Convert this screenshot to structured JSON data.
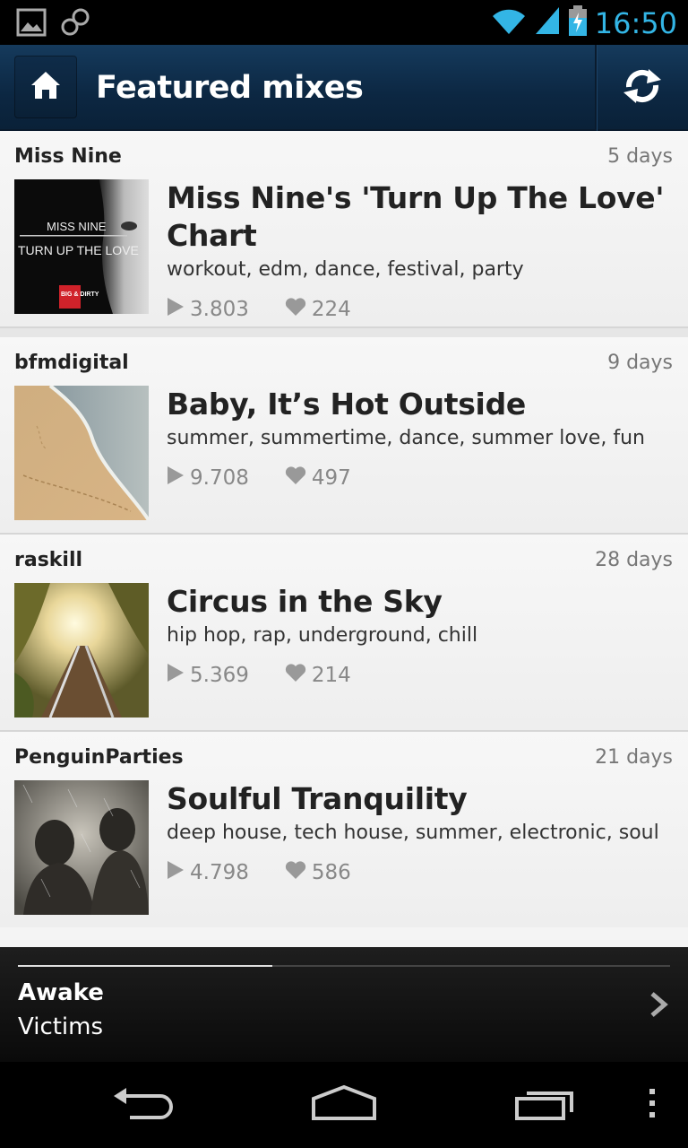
{
  "status_bar": {
    "time": "16:50",
    "icons": [
      "picture-icon",
      "infinity-icon",
      "wifi-icon",
      "signal-icon",
      "battery-icon"
    ]
  },
  "action_bar": {
    "title": "Featured mixes",
    "home_icon": "home-icon",
    "refresh_icon": "refresh-icon"
  },
  "mixes": [
    {
      "user": "Miss Nine",
      "age": "5 days",
      "title": "Miss Nine's 'Turn Up The Love' Chart",
      "tags": "workout, edm, dance, festival, party",
      "plays": "3.803",
      "likes": "224",
      "art_text": [
        "MISS NINE",
        "TURN UP THE LOVE",
        "BIG & DIRTY"
      ]
    },
    {
      "user": "bfmdigital",
      "age": "9 days",
      "title": "Baby, It’s Hot Outside",
      "tags": "summer, summertime, dance, summer love, fun",
      "plays": "9.708",
      "likes": "497"
    },
    {
      "user": "raskill",
      "age": "28 days",
      "title": "Circus in the Sky",
      "tags": "hip hop, rap, underground, chill",
      "plays": "5.369",
      "likes": "214"
    },
    {
      "user": "PenguinParties",
      "age": "21 days",
      "title": "Soulful Tranquility",
      "tags": "deep house, tech house, summer, electronic, soul",
      "plays": "4.798",
      "likes": "586"
    }
  ],
  "now_playing": {
    "track": "Awake",
    "artist": "Victims",
    "progress": 0.39
  },
  "nav_bar": {
    "icons": [
      "back-icon",
      "home-nav-icon",
      "recent-apps-icon",
      "overflow-menu-icon"
    ]
  },
  "colors": {
    "accent": "#33b5e5",
    "action_bar": "#0c2742",
    "card_bg": "#f4f4f4"
  }
}
